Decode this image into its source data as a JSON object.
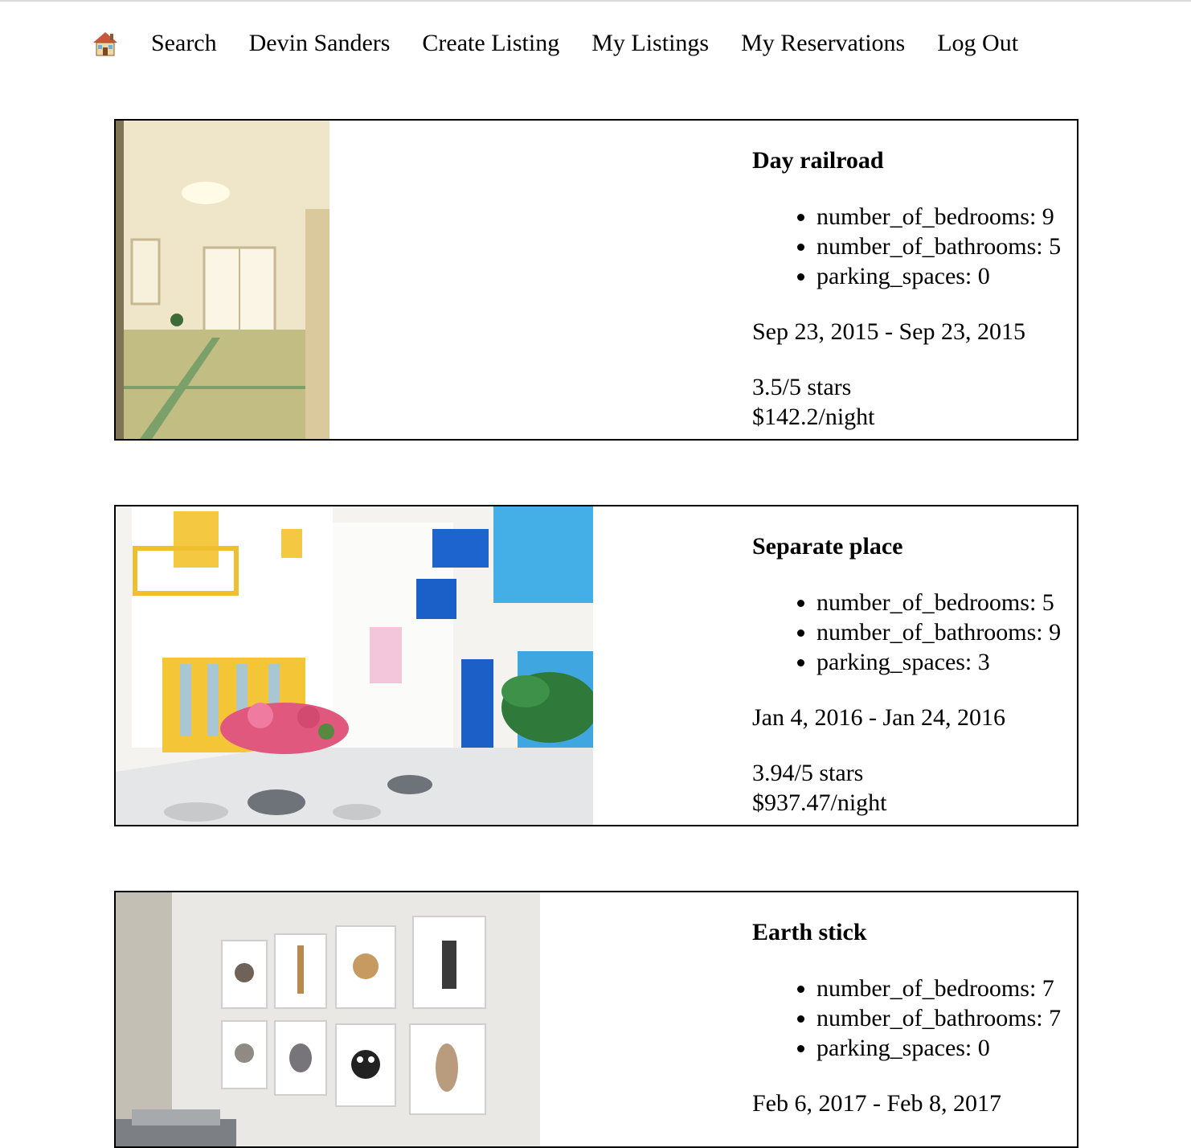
{
  "nav": {
    "home_icon": "house-icon",
    "items": [
      "Search",
      "Devin Sanders",
      "Create Listing",
      "My Listings",
      "My Reservations",
      "Log Out"
    ]
  },
  "listings": [
    {
      "title": "Day railroad",
      "features": [
        "number_of_bedrooms: 9",
        "number_of_bathrooms: 5",
        "parking_spaces: 0"
      ],
      "dates": "Sep 23, 2015 - Sep 23, 2015",
      "rating": "3.5/5 stars",
      "price": "$142.2/night"
    },
    {
      "title": "Separate place",
      "features": [
        "number_of_bedrooms: 5",
        "number_of_bathrooms: 9",
        "parking_spaces: 3"
      ],
      "dates": "Jan 4, 2016 - Jan 24, 2016",
      "rating": "3.94/5 stars",
      "price": "$937.47/night"
    },
    {
      "title": "Earth stick",
      "features": [
        "number_of_bedrooms: 7",
        "number_of_bathrooms: 7",
        "parking_spaces: 0"
      ],
      "dates": "Feb 6, 2017 - Feb 8, 2017",
      "rating": "",
      "price": ""
    }
  ]
}
